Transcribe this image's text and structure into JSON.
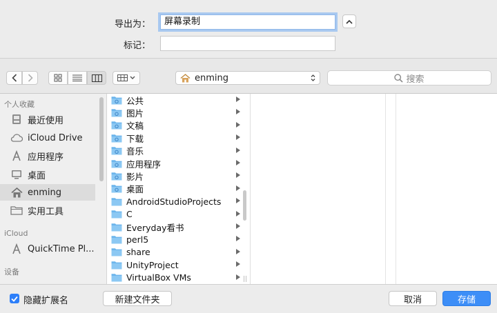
{
  "export": {
    "name_label": "导出为：",
    "name_value": "屏幕录制",
    "tags_label": "标记：",
    "tags_value": ""
  },
  "toolbar": {
    "location": "enming",
    "search_placeholder": "搜索"
  },
  "sidebar": {
    "sections": [
      {
        "header": "个人收藏",
        "items": [
          "最近使用",
          "iCloud Drive",
          "应用程序",
          "桌面",
          "enming",
          "实用工具"
        ]
      },
      {
        "header": "iCloud",
        "items": [
          "QuickTime Pl..."
        ]
      },
      {
        "header": "设备",
        "items": []
      }
    ],
    "selected": "enming"
  },
  "files": [
    {
      "name": "公共",
      "icon": "folder-public-icon"
    },
    {
      "name": "图片",
      "icon": "folder-pictures-icon"
    },
    {
      "name": "文稿",
      "icon": "folder-documents-icon"
    },
    {
      "name": "下载",
      "icon": "folder-downloads-icon"
    },
    {
      "name": "音乐",
      "icon": "folder-music-icon"
    },
    {
      "name": "应用程序",
      "icon": "folder-applications-icon"
    },
    {
      "name": "影片",
      "icon": "folder-movies-icon"
    },
    {
      "name": "桌面",
      "icon": "folder-desktop-icon"
    },
    {
      "name": "AndroidStudioProjects",
      "icon": "folder-icon"
    },
    {
      "name": "C",
      "icon": "folder-icon"
    },
    {
      "name": "Everyday看书",
      "icon": "folder-icon"
    },
    {
      "name": "perl5",
      "icon": "folder-icon"
    },
    {
      "name": "share",
      "icon": "folder-icon"
    },
    {
      "name": "UnityProject",
      "icon": "folder-icon"
    },
    {
      "name": "VirtualBox VMs",
      "icon": "folder-icon"
    }
  ],
  "bottom": {
    "hide_extension_label": "隐藏扩展名",
    "hide_extension_checked": true,
    "new_folder_label": "新建文件夹",
    "cancel_label": "取消",
    "save_label": "存储"
  },
  "colors": {
    "accent": "#3d8ef7",
    "folder": "#6cb5ec",
    "selection": "#dcdcdc"
  }
}
